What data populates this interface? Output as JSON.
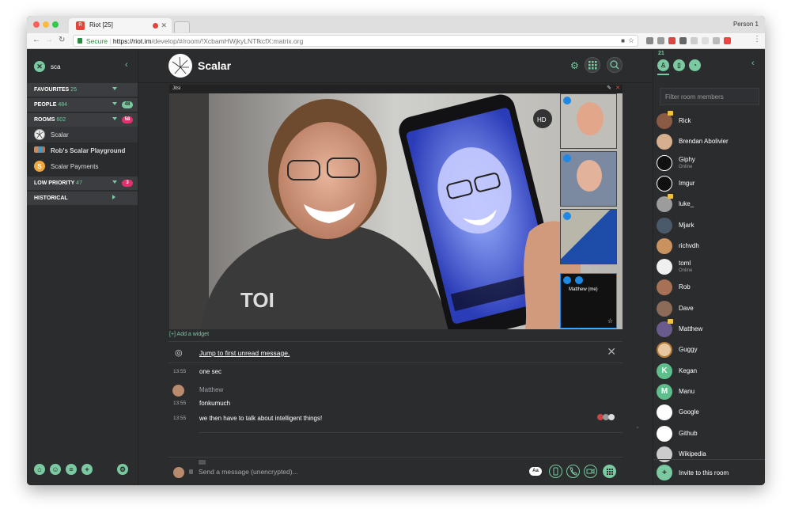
{
  "browser": {
    "tab_title": "Riot [25]",
    "profile": "Person 1",
    "url_secure": "Secure",
    "url_host": "https://riot.im",
    "url_path": "/develop/#/room/!XcbamHWjkyLNTfkcfX:matrix.org"
  },
  "left": {
    "search_value": "sca",
    "sections": [
      {
        "label": "FAVOURITES",
        "count": "25"
      },
      {
        "label": "PEOPLE",
        "count": "484",
        "badge": "48"
      },
      {
        "label": "ROOMS",
        "count": "602",
        "badge": "58"
      },
      {
        "label": "LOW PRIORITY",
        "count": "47",
        "badge": "3"
      },
      {
        "label": "HISTORICAL",
        "count": ""
      }
    ],
    "rooms": [
      {
        "name": "Scalar"
      },
      {
        "name": "Rob's Scalar Playground"
      },
      {
        "name": "Scalar Payments",
        "letter": "S"
      }
    ]
  },
  "room": {
    "name": "Scalar",
    "widget_title": "Jitsi",
    "hd_label": "HD",
    "self_tile_label": "Matthew (me)",
    "add_widget": "[+] Add a widget",
    "jump_unread": "Jump to first unread message.",
    "messages": [
      {
        "time": "13:55",
        "sender": "",
        "body": "one sec"
      },
      {
        "time": "",
        "sender": "Matthew",
        "body": ""
      },
      {
        "time": "13:55",
        "sender": "",
        "body": "fonkumuch"
      },
      {
        "time": "13:55",
        "sender": "",
        "body": "we then have to talk about intelligent things!"
      }
    ],
    "composer_placeholder": "Send a message (unencrypted)...",
    "format_toggle": "Aa"
  },
  "right": {
    "member_count": "21",
    "filter_placeholder": "Filter room members",
    "members": [
      {
        "name": "Rick",
        "status": ""
      },
      {
        "name": "Brendan Abolivier",
        "status": ""
      },
      {
        "name": "Giphy",
        "status": "Online"
      },
      {
        "name": "Imgur",
        "status": ""
      },
      {
        "name": "luke_",
        "status": ""
      },
      {
        "name": "Mjark",
        "status": ""
      },
      {
        "name": "richvdh",
        "status": ""
      },
      {
        "name": "toml",
        "status": "Online"
      },
      {
        "name": "Rob",
        "status": ""
      },
      {
        "name": "Dave",
        "status": ""
      },
      {
        "name": "Matthew",
        "status": ""
      },
      {
        "name": "Guggy",
        "status": ""
      },
      {
        "name": "Kegan",
        "status": "",
        "letter": "K"
      },
      {
        "name": "Manu",
        "status": "",
        "letter": "M"
      },
      {
        "name": "Google",
        "status": ""
      },
      {
        "name": "Github",
        "status": ""
      },
      {
        "name": "Wikipedia",
        "status": ""
      }
    ],
    "invite_label": "Invite to this room"
  },
  "colors": {
    "accent": "#7ac9a1",
    "badge_red": "#e0336e",
    "panel_bg": "#2b2c2e"
  }
}
